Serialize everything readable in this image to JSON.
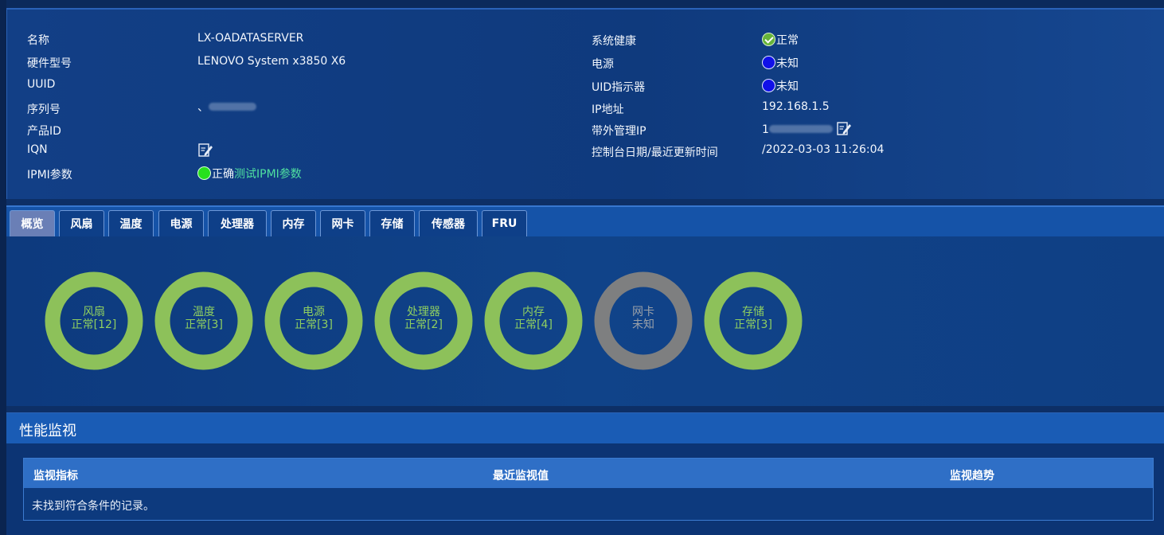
{
  "info": {
    "left": [
      {
        "label": "名称",
        "value": "LX-OADATASERVER"
      },
      {
        "label": "硬件型号",
        "value": "LENOVO System x3850 X6"
      },
      {
        "label": "UUID",
        "value": ""
      },
      {
        "label": "序列号",
        "value": "、"
      },
      {
        "label": "产品ID",
        "value": ""
      },
      {
        "label": "IQN",
        "value": ""
      },
      {
        "label": "IPMI参数",
        "value": "正确",
        "link": "测试IPMI参数"
      }
    ],
    "right": [
      {
        "label": "系统健康",
        "value": "正常"
      },
      {
        "label": "电源",
        "value": "未知"
      },
      {
        "label": "UID指示器",
        "value": "未知"
      },
      {
        "label": "IP地址",
        "value": "192.168.1.5"
      },
      {
        "label": "带外管理IP",
        "value": "1"
      },
      {
        "label": "控制台日期/最近更新时间",
        "value": "/2022-03-03 11:26:04"
      }
    ]
  },
  "tabs": [
    "概览",
    "风扇",
    "温度",
    "电源",
    "处理器",
    "内存",
    "网卡",
    "存储",
    "传感器",
    "FRU"
  ],
  "rings": [
    {
      "name": "风扇",
      "status": "正常[12]",
      "color": "#8dc15a"
    },
    {
      "name": "温度",
      "status": "正常[3]",
      "color": "#8dc15a"
    },
    {
      "name": "电源",
      "status": "正常[3]",
      "color": "#8dc15a"
    },
    {
      "name": "处理器",
      "status": "正常[2]",
      "color": "#8dc15a"
    },
    {
      "name": "内存",
      "status": "正常[4]",
      "color": "#8dc15a"
    },
    {
      "name": "网卡",
      "status": "未知",
      "color": "#7e7f80"
    },
    {
      "name": "存储",
      "status": "正常[3]",
      "color": "#8dc15a"
    }
  ],
  "perf": {
    "title": "性能监视",
    "columns": [
      "监视指标",
      "最近监视值",
      "监视趋势"
    ],
    "empty": "未找到符合条件的记录。"
  }
}
